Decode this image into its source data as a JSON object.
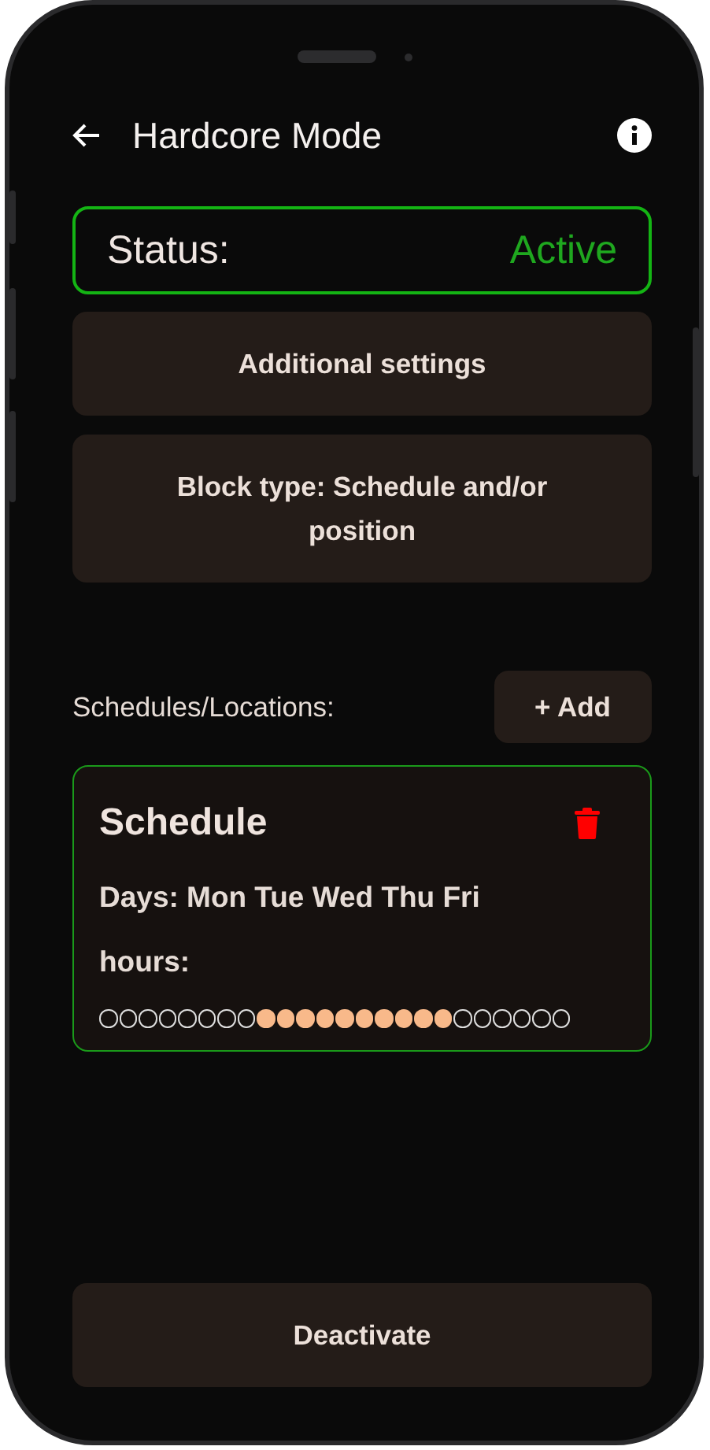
{
  "app_bar": {
    "title": "Hardcore Mode"
  },
  "status": {
    "label": "Status:",
    "value": "Active",
    "active": true
  },
  "settings_button": "Additional settings",
  "block_type_button": "Block type: Schedule and/or position",
  "schedules_section": {
    "label": "Schedules/Locations:",
    "add_button": "+ Add"
  },
  "schedules": [
    {
      "title": "Schedule",
      "days": "Days: Mon Tue Wed Thu Fri",
      "hours_label": "hours:",
      "hours": [
        {
          "on": false
        },
        {
          "on": false
        },
        {
          "on": false
        },
        {
          "on": false
        },
        {
          "on": false
        },
        {
          "on": false
        },
        {
          "on": false
        },
        {
          "on": false
        },
        {
          "on": true
        },
        {
          "on": true
        },
        {
          "on": true
        },
        {
          "on": true
        },
        {
          "on": true
        },
        {
          "on": true
        },
        {
          "on": true
        },
        {
          "on": true
        },
        {
          "on": true
        },
        {
          "on": true
        },
        {
          "on": false
        },
        {
          "on": false
        },
        {
          "on": false
        },
        {
          "on": false
        },
        {
          "on": false
        },
        {
          "on": false
        }
      ]
    }
  ],
  "deactivate_button": "Deactivate"
}
